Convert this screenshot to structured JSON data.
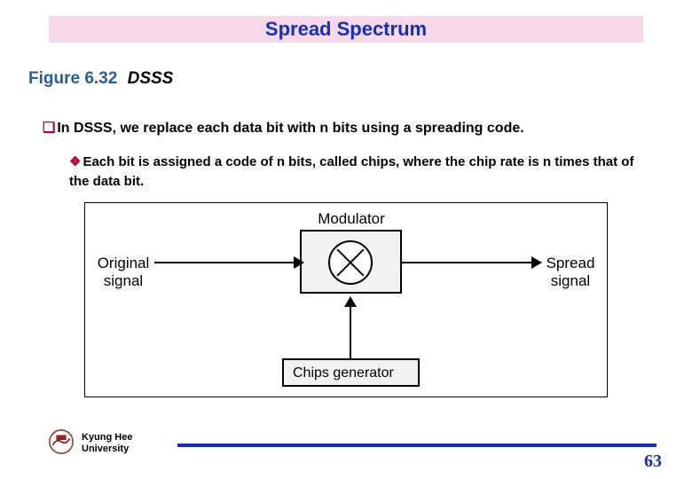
{
  "title": "Spread Spectrum",
  "figure": {
    "label": "Figure 6.32",
    "caption": "DSSS"
  },
  "bullets": {
    "b1_marker": "❑",
    "b1_text": "In DSSS, we replace each data bit with n bits using a spreading code.",
    "b2_marker": "❖",
    "b2_text": "Each bit is assigned a code of n bits, called chips, where the chip rate is n times that of the data bit."
  },
  "diagram": {
    "modulator": "Modulator",
    "original_signal": "Original signal",
    "spread_signal": "Spread signal",
    "chips_generator": "Chips generator"
  },
  "footer": {
    "org_line1": "Kyung Hee",
    "org_line2": "University",
    "page": "63"
  }
}
